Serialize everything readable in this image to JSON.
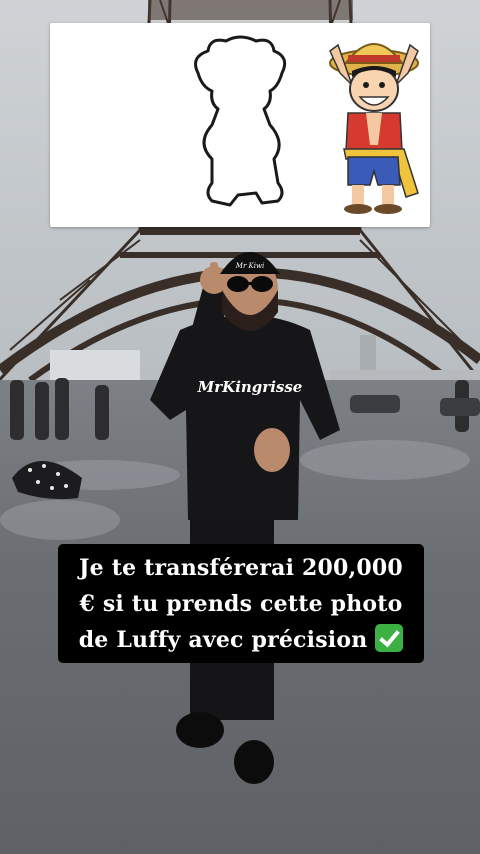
{
  "caption": {
    "text": "Je te transférerai 200,000 € si tu prends cette photo de Luffy avec précision",
    "emoji": "check-mark-button"
  },
  "person": {
    "beanie_text": "Mr Kiwi",
    "hoodie_text": "MrKingrisse"
  },
  "card": {
    "left_image": "luffy-silhouette-outline",
    "right_image": "luffy-cartoon"
  }
}
